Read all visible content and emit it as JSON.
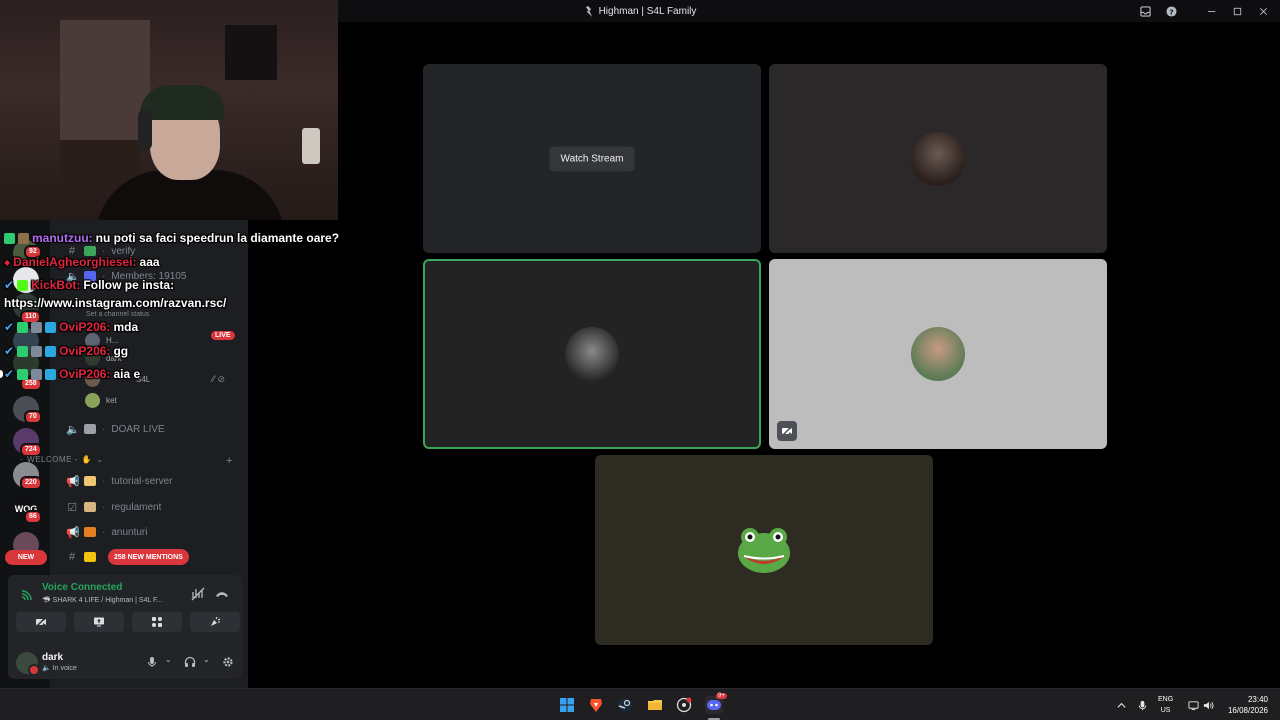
{
  "window": {
    "title": "Highman | S4L Family"
  },
  "chat_overlay": [
    {
      "user": "manutzuu:",
      "message": "nu poti sa faci speedrun la diamante oare?"
    },
    {
      "user": "DanielAgheorghiesei:",
      "message": "aaa"
    },
    {
      "user": "KickBot:",
      "message": "Follow pe insta:"
    },
    {
      "user": "",
      "message": "https://www.instagram.com/razvan.rsc/"
    },
    {
      "user": "OviP206:",
      "message": "mda"
    },
    {
      "user": "OviP206:",
      "message": "gg"
    },
    {
      "user": "OviP206:",
      "message": "aia e"
    }
  ],
  "guilds": {
    "badges": [
      "92",
      "110",
      "258",
      "70",
      "724",
      "220",
      "86"
    ],
    "new_label": "NEW",
    "mentions_label": "258 NEW MENTIONS"
  },
  "sidebar": {
    "verify": "verify",
    "members": "Members: 19105",
    "live_tag": "LIVE",
    "set_status": "Set a channel status",
    "members_in_voice": [
      "H...",
      "dark",
      "S4L",
      "ket"
    ],
    "doar_live": "DOAR LIVE",
    "category_welcome": "WELCOME -",
    "channels": [
      "tutorial-server",
      "regulament",
      "anunturi"
    ]
  },
  "voice": {
    "title": "Voice Connected",
    "subtitle": "SHARK 4 LIFE / Highman | S4L F..."
  },
  "user": {
    "name": "dark",
    "status": "In voice"
  },
  "stage": {
    "watch_label": "Watch Stream"
  },
  "tray": {
    "lang1": "ENG",
    "lang2": "US",
    "time": "23:40",
    "date": "16/08/2026",
    "discord_badge": "9+"
  },
  "colors": {
    "discord_red": "#da373c",
    "voice_green": "#23a55a",
    "speaking_border": "#3ba55c"
  }
}
